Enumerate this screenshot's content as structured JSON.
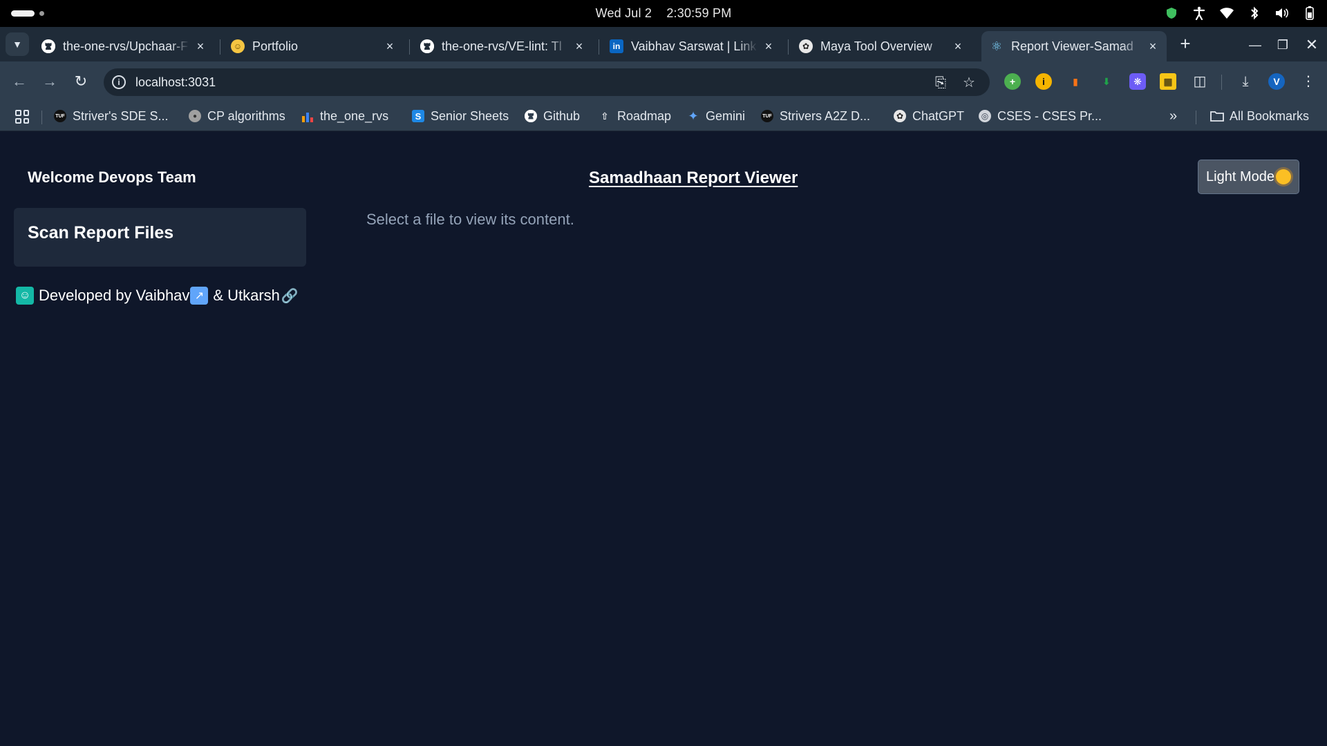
{
  "os": {
    "date": "Wed Jul 2",
    "time": "2:30:59 PM",
    "tray_icons": [
      "shield-icon",
      "accessibility-icon",
      "wifi-icon",
      "bluetooth-icon",
      "volume-icon",
      "battery-icon"
    ]
  },
  "browser": {
    "tabs": [
      {
        "title": "the-one-rvs/Upchaar-F",
        "favicon": "github-icon",
        "active": false
      },
      {
        "title": "Portfolio",
        "favicon": "portfolio-icon",
        "active": false
      },
      {
        "title": "the-one-rvs/VE-lint: Tl",
        "favicon": "github-icon",
        "active": false
      },
      {
        "title": "Vaibhav Sarswat | Link",
        "favicon": "linkedin-icon",
        "active": false
      },
      {
        "title": "Maya Tool Overview",
        "favicon": "chatgpt-icon",
        "active": false
      },
      {
        "title": "Report Viewer-Samad",
        "favicon": "react-icon",
        "active": true
      }
    ],
    "close_glyph": "×",
    "new_tab_glyph": "+",
    "url": "localhost:3031",
    "bookmarks": [
      {
        "label": "Striver's SDE S...",
        "icon": "tuf-icon"
      },
      {
        "label": "CP algorithms",
        "icon": "cp-algorithms-icon"
      },
      {
        "label": "the_one_rvs",
        "icon": "bar-chart-icon"
      },
      {
        "label": "Senior Sheets",
        "icon": "sheets-icon"
      },
      {
        "label": "Github",
        "icon": "github-icon"
      },
      {
        "label": "Roadmap",
        "icon": "rocket-icon"
      },
      {
        "label": "Gemini",
        "icon": "gemini-icon"
      },
      {
        "label": "Strivers A2Z D...",
        "icon": "tuf-icon"
      },
      {
        "label": "ChatGPT",
        "icon": "chatgpt-icon"
      },
      {
        "label": "CSES - CSES Pr...",
        "icon": "globe-icon"
      }
    ],
    "bookmarks_overflow": "»",
    "all_bookmarks": "All Bookmarks",
    "profile_initial": "V"
  },
  "app": {
    "welcome": "Welcome Devops Team",
    "sidebar_heading": "Scan Report Files",
    "credit": {
      "prefix": "Developed by",
      "dev1": "Vaibhav",
      "connector": "&",
      "dev2": "Utkarsh"
    },
    "title": "Samadhaan Report Viewer",
    "placeholder": "Select a file to view its content.",
    "theme_button": "Light Mode"
  },
  "colors": {
    "page_bg": "#0f172a",
    "card_bg": "#1e293b",
    "button_bg": "#4b5563",
    "muted_text": "#94a3b8",
    "chrome_bg": "#2f3e4e",
    "tabstrip_bg": "#1f2b38"
  }
}
